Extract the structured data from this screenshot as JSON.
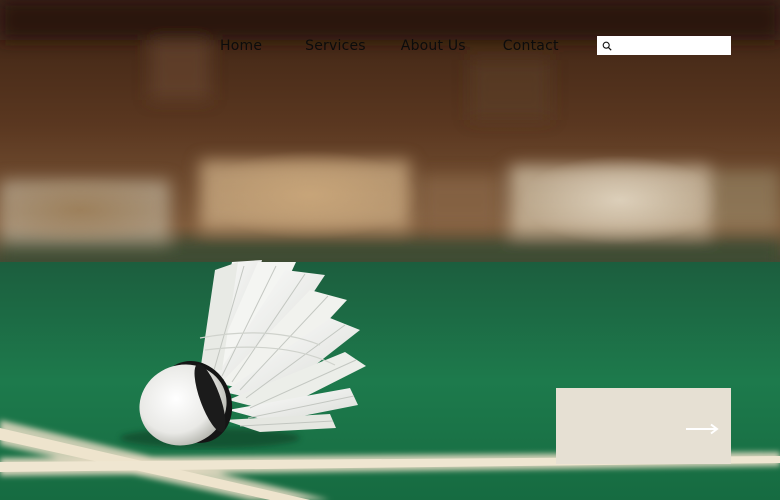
{
  "nav": {
    "items": [
      {
        "label": "Home"
      },
      {
        "label": "Services"
      },
      {
        "label": "About Us"
      },
      {
        "label": "Contact"
      }
    ]
  },
  "search": {
    "placeholder": "",
    "value": "",
    "icon": "search-icon"
  },
  "cta": {
    "icon": "arrow-right-icon"
  },
  "colors": {
    "court_green": "#1f7a4f",
    "cta_background": "#e6e0d3",
    "nav_text": "#0c0c0c"
  }
}
